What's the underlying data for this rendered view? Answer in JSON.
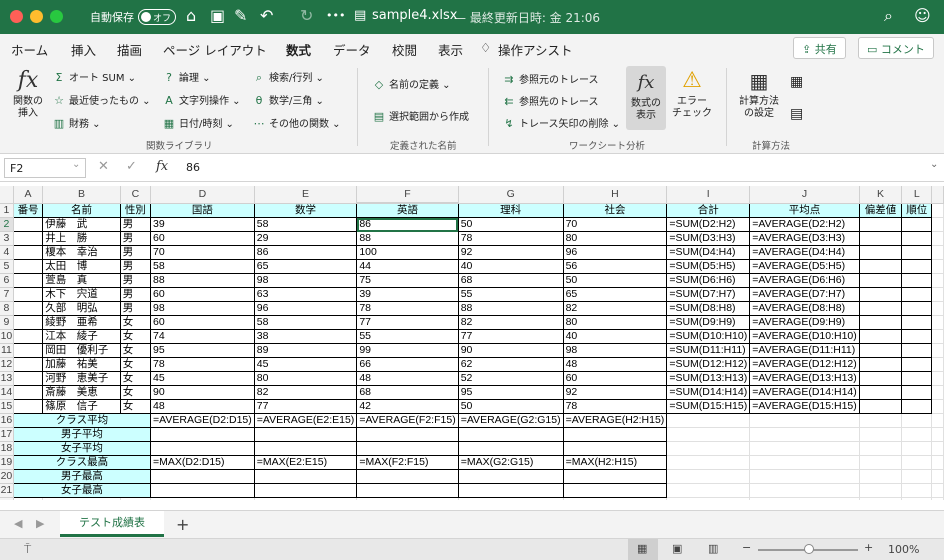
{
  "titlebar": {
    "autosave": "自動保存",
    "autosave_state": "オフ",
    "filename": "sample4.xlsx",
    "subtitle": "— 最終更新日時: 金 21:06"
  },
  "menu": {
    "tabs": [
      "ホーム",
      "挿入",
      "描画",
      "ページ レイアウト",
      "数式",
      "データ",
      "校閲",
      "表示"
    ],
    "active": "数式",
    "tell_me": "操作アシスト",
    "share": "共有",
    "comments": "コメント"
  },
  "ribbon": {
    "insert_function": "関数の\n挿入",
    "autosum": "オート SUM",
    "recent": "最近使ったもの",
    "financial": "財務",
    "logical": "論理",
    "text": "文字列操作",
    "datetime": "日付/時刻",
    "lookup": "検索/行列",
    "math": "数学/三角",
    "more": "その他の関数",
    "define_name": "名前の定義",
    "create_from_sel": "選択範囲から作成",
    "trace_precedents": "参照元のトレース",
    "trace_dependents": "参照先のトレース",
    "remove_arrows": "トレース矢印の削除",
    "show_formulas": "数式の\n表示",
    "error_check": "エラー\nチェック",
    "calc_options": "計算方法\nの設定",
    "group_library": "関数ライブラリ",
    "group_names": "定義された名前",
    "group_audit": "ワークシート分析",
    "group_calc": "計算方法"
  },
  "formula_bar": {
    "name_box": "F2",
    "fx": "fx",
    "value": "86"
  },
  "columns": [
    "A",
    "B",
    "C",
    "D",
    "E",
    "F",
    "G",
    "H",
    "I",
    "J",
    "K",
    "L"
  ],
  "header_row": [
    "番号",
    "名前",
    "性別",
    "国語",
    "数学",
    "英語",
    "理科",
    "社会",
    "合計",
    "平均点",
    "偏差値",
    "順位"
  ],
  "students": [
    [
      "伊藤　武",
      "男",
      "39",
      "58",
      "86",
      "50",
      "70",
      "=SUM(D2:H2)",
      "=AVERAGE(D2:H2)"
    ],
    [
      "井上　勝",
      "男",
      "60",
      "29",
      "88",
      "78",
      "80",
      "=SUM(D3:H3)",
      "=AVERAGE(D3:H3)"
    ],
    [
      "榎本　幸治",
      "男",
      "70",
      "86",
      "100",
      "92",
      "96",
      "=SUM(D4:H4)",
      "=AVERAGE(D4:H4)"
    ],
    [
      "太田　博",
      "男",
      "58",
      "65",
      "44",
      "40",
      "56",
      "=SUM(D5:H5)",
      "=AVERAGE(D5:H5)"
    ],
    [
      "萱島　真",
      "男",
      "88",
      "98",
      "75",
      "68",
      "50",
      "=SUM(D6:H6)",
      "=AVERAGE(D6:H6)"
    ],
    [
      "木下　宍道",
      "男",
      "60",
      "63",
      "39",
      "55",
      "65",
      "=SUM(D7:H7)",
      "=AVERAGE(D7:H7)"
    ],
    [
      "久部　明弘",
      "男",
      "98",
      "96",
      "78",
      "88",
      "82",
      "=SUM(D8:H8)",
      "=AVERAGE(D8:H8)"
    ],
    [
      "綾野　亜希",
      "女",
      "60",
      "58",
      "77",
      "82",
      "80",
      "=SUM(D9:H9)",
      "=AVERAGE(D9:H9)"
    ],
    [
      "江本　綾子",
      "女",
      "74",
      "38",
      "55",
      "77",
      "40",
      "=SUM(D10:H10)",
      "=AVERAGE(D10:H10)"
    ],
    [
      "岡田　優利子",
      "女",
      "95",
      "89",
      "99",
      "90",
      "98",
      "=SUM(D11:H11)",
      "=AVERAGE(D11:H11)"
    ],
    [
      "加藤　祐美",
      "女",
      "78",
      "45",
      "66",
      "62",
      "48",
      "=SUM(D12:H12)",
      "=AVERAGE(D12:H12)"
    ],
    [
      "河野　恵美子",
      "女",
      "45",
      "80",
      "48",
      "52",
      "60",
      "=SUM(D13:H13)",
      "=AVERAGE(D13:H13)"
    ],
    [
      "斎藤　美恵",
      "女",
      "90",
      "82",
      "68",
      "95",
      "92",
      "=SUM(D14:H14)",
      "=AVERAGE(D14:H14)"
    ],
    [
      "篠原　信子",
      "女",
      "48",
      "77",
      "42",
      "50",
      "78",
      "=SUM(D15:H15)",
      "=AVERAGE(D15:H15)"
    ]
  ],
  "summary": [
    {
      "label": "クラス平均",
      "values": [
        "=AVERAGE(D2:D15)",
        "=AVERAGE(E2:E15)",
        "=AVERAGE(F2:F15)",
        "=AVERAGE(G2:G15)",
        "=AVERAGE(H2:H15)"
      ]
    },
    {
      "label": "男子平均",
      "values": [
        "",
        "",
        "",
        "",
        ""
      ]
    },
    {
      "label": "女子平均",
      "values": [
        "",
        "",
        "",
        "",
        ""
      ]
    },
    {
      "label": "クラス最高",
      "values": [
        "=MAX(D2:D15)",
        "=MAX(E2:E15)",
        "=MAX(F2:F15)",
        "=MAX(G2:G15)",
        "=MAX(H2:H15)"
      ]
    },
    {
      "label": "男子最高",
      "values": [
        "",
        "",
        "",
        "",
        ""
      ]
    },
    {
      "label": "女子最高",
      "values": [
        "",
        "",
        "",
        "",
        ""
      ]
    }
  ],
  "sheet": {
    "tab": "テスト成績表",
    "add": "+"
  },
  "status": {
    "zoom": "100%"
  }
}
